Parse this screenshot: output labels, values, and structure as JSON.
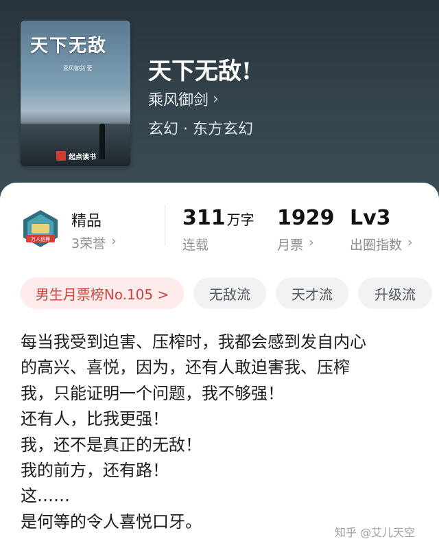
{
  "cover": {
    "title": "天下无敌",
    "author": "乘风御剑 著",
    "brand": "起点读书"
  },
  "book": {
    "title": "天下无敌!",
    "author": "乘风御剑",
    "genre": "玄幻 · 东方玄幻"
  },
  "stats": {
    "honor_badge_text": "万人追捧",
    "quality": "精品",
    "honors": "3荣誉",
    "word_count": "311",
    "word_unit": "万字",
    "status": "连载",
    "monthly_tickets": "1929",
    "monthly_tickets_label": "月票",
    "level": "Lv3",
    "level_label": "出圈指数"
  },
  "tags": [
    "男生月票榜No.105 >",
    "无敌流",
    "天才流",
    "升级流"
  ],
  "intro": [
    "每当我受到迫害、压榨时，我都会感到发自内心",
    "的高兴、喜悦，因为，还有人敢迫害我、压榨",
    "我，只能证明一个问题，我不够强！",
    "还有人，比我更强！",
    "我，还不是真正的无敌！",
    "我的前方，还有路！",
    "这……",
    "是何等的令人喜悦口牙。"
  ],
  "watermark": "知乎 @艾儿天空",
  "colors": {
    "hero_bg": "#2f3b44",
    "rank_tag_bg": "#fdeceb",
    "rank_tag_text": "#d0433d"
  }
}
